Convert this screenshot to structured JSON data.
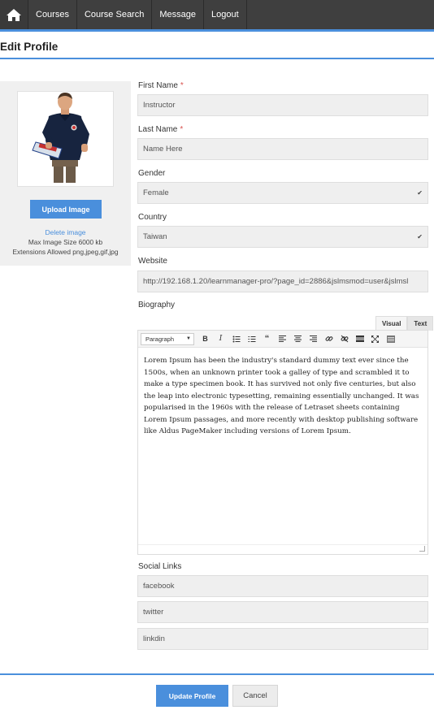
{
  "nav": {
    "home_icon": "home-icon",
    "items": [
      "Courses",
      "Course Search",
      "Message",
      "Logout"
    ]
  },
  "page": {
    "title": "Edit Profile"
  },
  "profile_image": {
    "upload_label": "Upload Image",
    "delete_label": "Delete image",
    "max_size": "Max Image Size 6000 kb",
    "extensions": "Extensions Allowed png,jpeg,gif,jpg"
  },
  "form": {
    "first_name": {
      "label": "First Name",
      "required": "*",
      "value": "Instructor"
    },
    "last_name": {
      "label": "Last Name",
      "required": "*",
      "value": "Name Here"
    },
    "gender": {
      "label": "Gender",
      "value": "Female"
    },
    "country": {
      "label": "Country",
      "value": "Taiwan"
    },
    "website": {
      "label": "Website",
      "value": "http://192.168.1.20/learnmanager-pro/?page_id=2886&jslmsmod=user&jslmsl"
    },
    "biography": {
      "label": "Biography",
      "tab_visual": "Visual",
      "tab_text": "Text",
      "format_select": "Paragraph",
      "content": "Lorem Ipsum has been the industry's standard dummy text ever since the 1500s, when an unknown printer took a galley of type and scrambled it to make a type specimen book. It has survived not only five centuries, but also the leap into electronic typesetting, remaining essentially unchanged. It was popularised in the 1960s with the release of Letraset sheets containing Lorem Ipsum passages, and more recently with desktop publishing software like Aldus PageMaker including versions of Lorem Ipsum."
    },
    "social": {
      "label": "Social Links",
      "facebook": "facebook",
      "twitter": "twitter",
      "linkedin": "linkdin"
    }
  },
  "actions": {
    "update": "Update Profile",
    "cancel": "Cancel"
  },
  "colors": {
    "accent": "#4a8fdc",
    "nav_bg": "#3f3f3f",
    "field_bg": "#efefef",
    "required": "#d9534f"
  }
}
